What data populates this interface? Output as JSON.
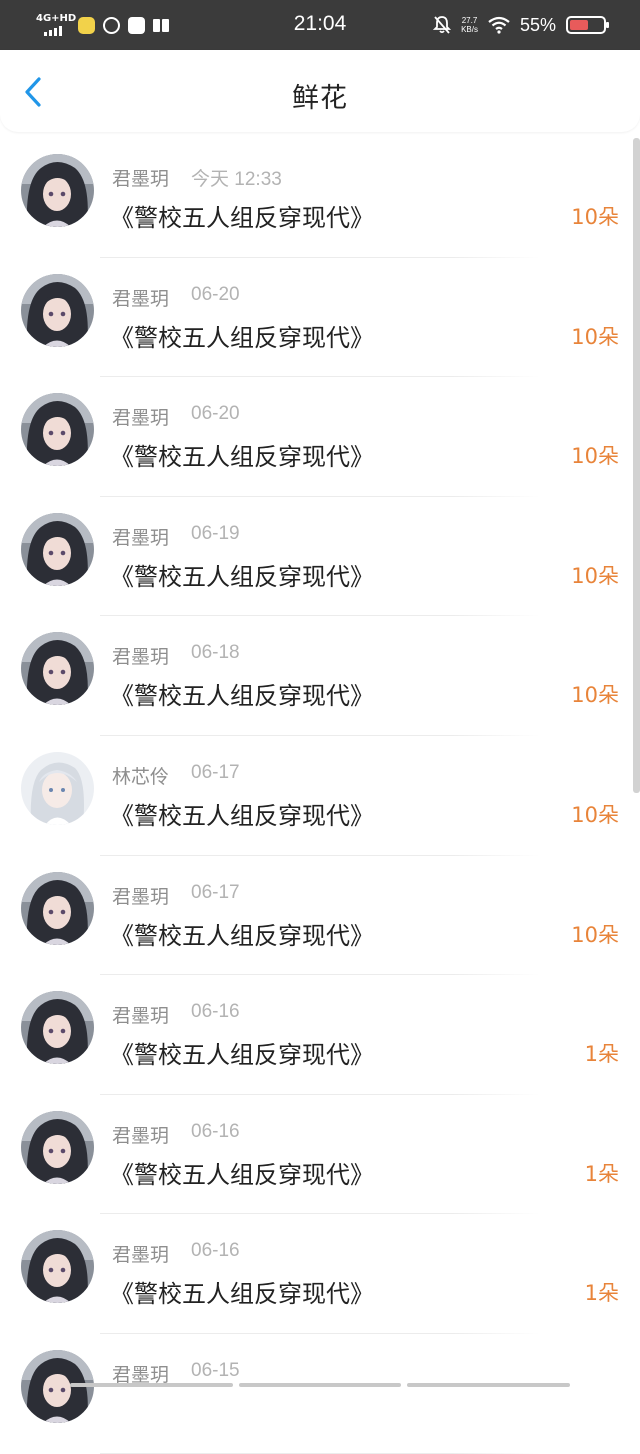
{
  "status_bar": {
    "network": "4G+HD",
    "time": "21:04",
    "speed_value": "27.7",
    "speed_unit": "KB/s",
    "battery": "55%"
  },
  "header": {
    "title": "鲜花",
    "back_icon": "chevron-left-icon"
  },
  "colors": {
    "accent": "#2196e8",
    "amount": "#e8843a",
    "status_bg": "#3b3b3b"
  },
  "records": [
    {
      "name": "君墨玥",
      "date": "今天 12:33",
      "title": "《警校五人组反穿现代》",
      "amount": "10朵",
      "avatar": "dark"
    },
    {
      "name": "君墨玥",
      "date": "06-20",
      "title": "《警校五人组反穿现代》",
      "amount": "10朵",
      "avatar": "dark"
    },
    {
      "name": "君墨玥",
      "date": "06-20",
      "title": "《警校五人组反穿现代》",
      "amount": "10朵",
      "avatar": "dark"
    },
    {
      "name": "君墨玥",
      "date": "06-19",
      "title": "《警校五人组反穿现代》",
      "amount": "10朵",
      "avatar": "dark"
    },
    {
      "name": "君墨玥",
      "date": "06-18",
      "title": "《警校五人组反穿现代》",
      "amount": "10朵",
      "avatar": "dark"
    },
    {
      "name": "林芯伶",
      "date": "06-17",
      "title": "《警校五人组反穿现代》",
      "amount": "10朵",
      "avatar": "light"
    },
    {
      "name": "君墨玥",
      "date": "06-17",
      "title": "《警校五人组反穿现代》",
      "amount": "10朵",
      "avatar": "dark"
    },
    {
      "name": "君墨玥",
      "date": "06-16",
      "title": "《警校五人组反穿现代》",
      "amount": "1朵",
      "avatar": "dark"
    },
    {
      "name": "君墨玥",
      "date": "06-16",
      "title": "《警校五人组反穿现代》",
      "amount": "1朵",
      "avatar": "dark"
    },
    {
      "name": "君墨玥",
      "date": "06-16",
      "title": "《警校五人组反穿现代》",
      "amount": "1朵",
      "avatar": "dark"
    },
    {
      "name": "君墨玥",
      "date": "06-15",
      "title": "",
      "amount": "",
      "avatar": "dark"
    }
  ]
}
